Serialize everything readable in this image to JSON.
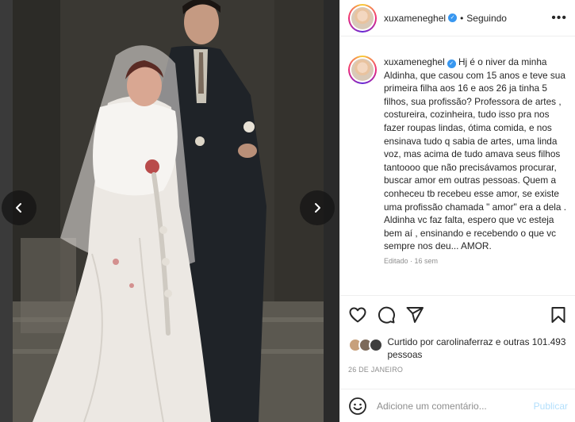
{
  "post": {
    "username": "xuxameneghel",
    "follow_state": "Seguindo",
    "dot": "•",
    "more": "•••",
    "caption_user": "xuxameneghel",
    "caption": "Hj é o niver da minha Aldinha, que casou com 15 anos e teve sua primeira filha aos 16 e aos 26 ja tinha 5 filhos, sua profissão? Professora de artes , costureira, cozinheira, tudo isso pra nos fazer roupas lindas, ótima comida, e nos ensinava tudo q sabia de artes, uma linda voz, mas acima de tudo amava seus filhos tantoooo que não precisávamos procurar, buscar amor em outras pessoas. Quem a conheceu tb recebeu esse amor, se existe uma profissão chamada \" amor\" era a dela . Aldinha vc faz falta, espero que vc esteja bem aí , ensinando e recebendo o que vc sempre nos deu... AMOR.",
    "edited": "Editado · 16 sem",
    "liked_by_prefix": "Curtido por ",
    "liked_by_user": "carolinaferraz",
    "liked_by_suffix": " e outras 101.493 pessoas",
    "date": "26 DE JANEIRO",
    "comment_placeholder": "Adicione um comentário...",
    "publish_label": "Publicar"
  },
  "icons": {
    "prev": "chevron-left-icon",
    "next": "chevron-right-icon",
    "like": "heart-icon",
    "comment": "comment-icon",
    "share": "paper-plane-icon",
    "save": "bookmark-icon",
    "emoji": "emoji-icon",
    "verified": "verified-badge-icon"
  },
  "colors": {
    "verified": "#3897f0",
    "publish_disabled": "#b2dffc",
    "muted_text": "#8e8e8e",
    "text": "#262626"
  }
}
